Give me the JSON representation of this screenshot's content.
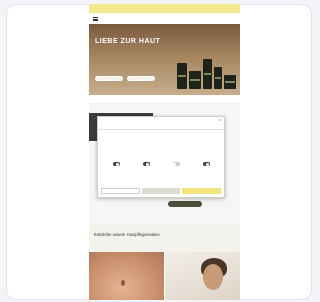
{
  "browser": {
    "promo_text": "",
    "menu_icon": "hamburger-icon"
  },
  "hero": {
    "title": "LIEBE ZUR HAUT",
    "subtitle": "",
    "buttons": [
      "",
      ""
    ],
    "colors": {
      "top": "#7a5a3c",
      "bottom": "#c7ae8c"
    }
  },
  "categories": [
    "",
    "",
    "",
    ""
  ],
  "cookie_modal": {
    "brand": "",
    "close_icon": "close-icon",
    "tabs": [
      "",
      "",
      ""
    ],
    "title": "",
    "body": "",
    "toggles": [
      {
        "label": "",
        "on": true
      },
      {
        "label": "",
        "on": true
      },
      {
        "label": "",
        "on": false
      },
      {
        "label": "",
        "on": true
      }
    ],
    "buttons": [
      "",
      "",
      ""
    ]
  },
  "section_button": "",
  "discover_heading": "Entdecke unsere Hautpflegeroutine",
  "accent_colors": {
    "promo": "#f3ea8f",
    "accept": "#f2e47c",
    "dark_button": "#4a4f3c"
  }
}
